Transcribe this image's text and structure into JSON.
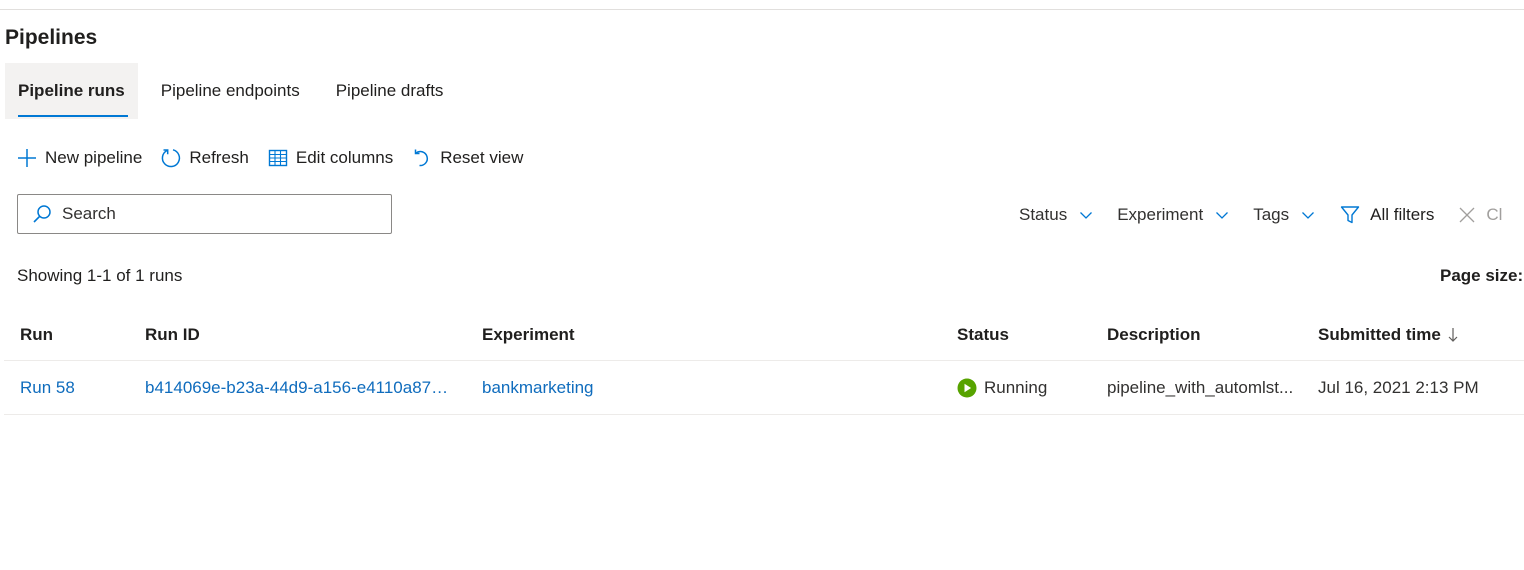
{
  "page": {
    "title": "Pipelines"
  },
  "tabs": [
    {
      "label": "Pipeline runs",
      "active": true
    },
    {
      "label": "Pipeline endpoints",
      "active": false
    },
    {
      "label": "Pipeline drafts",
      "active": false
    }
  ],
  "toolbar": {
    "new_pipeline": {
      "label": "New pipeline",
      "icon": "plus-icon"
    },
    "refresh": {
      "label": "Refresh",
      "icon": "refresh-icon"
    },
    "edit_columns": {
      "label": "Edit columns",
      "icon": "table-columns-icon"
    },
    "reset_view": {
      "label": "Reset view",
      "icon": "reset-icon"
    }
  },
  "search": {
    "placeholder": "Search",
    "value": ""
  },
  "filters": {
    "status": "Status",
    "experiment": "Experiment",
    "tags": "Tags",
    "all_filters": "All filters",
    "clear": "Cl"
  },
  "summary": {
    "showing": "Showing 1-1 of 1 runs",
    "page_size_label": "Page size:"
  },
  "table": {
    "columns": {
      "run": "Run",
      "run_id": "Run ID",
      "experiment": "Experiment",
      "status": "Status",
      "description": "Description",
      "submitted_time": "Submitted time"
    },
    "sort": {
      "column": "submitted_time",
      "direction": "descending"
    },
    "rows": [
      {
        "run": "Run 58",
        "run_id": "b414069e-b23a-44d9-a156-e4110a871f...",
        "experiment": "bankmarketing",
        "status": "Running",
        "description": "pipeline_with_automlst...",
        "submitted_time": "Jul 16, 2021 2:13 PM"
      }
    ]
  },
  "colors": {
    "accent": "#0078d4",
    "link": "#0f6cbd",
    "running": "#57a300",
    "text": "#201f1e",
    "disabled": "#a19f9d",
    "border": "#8a8886"
  }
}
